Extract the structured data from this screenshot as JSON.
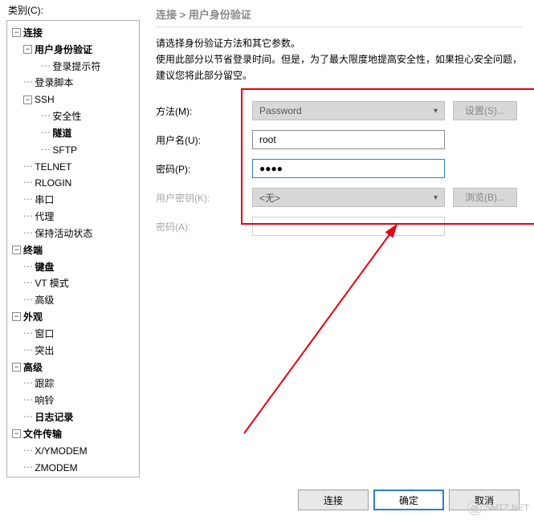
{
  "categoryLabel": "类别(C):",
  "tree": {
    "connection": "连接",
    "userAuth": "用户身份验证",
    "loginPrompt": "登录提示符",
    "loginScript": "登录脚本",
    "ssh": "SSH",
    "security": "安全性",
    "tunnel": "隧道",
    "sftp": "SFTP",
    "telnet": "TELNET",
    "rlogin": "RLOGIN",
    "serial": "串口",
    "proxy": "代理",
    "keepalive": "保持活动状态",
    "terminal": "终端",
    "keyboard": "键盘",
    "vtmode": "VT 模式",
    "advancedTerm": "高级",
    "appearance": "外观",
    "window": "窗口",
    "highlight": "突出",
    "advancedGrp": "高级",
    "trace": "跟踪",
    "bell": "响铃",
    "logging": "日志记录",
    "fileTransfer": "文件传输",
    "xymodem": "X/YMODEM",
    "zmodem": "ZMODEM"
  },
  "breadcrumb": "连接 > 用户身份验证",
  "desc1": "请选择身份验证方法和其它参数。",
  "desc2": "使用此部分以节省登录时间。但是，为了最大限度地提高安全性，如果担心安全问题，建议您将此部分留空。",
  "form": {
    "methodLabel": "方法(M):",
    "methodValue": "Password",
    "settingsBtn": "设置(S)...",
    "userLabel": "用户名(U):",
    "userValue": "root",
    "passLabel": "密码(P):",
    "passValue": "●●●●",
    "keyLabel": "用户密钥(K):",
    "keyValue": "<无>",
    "browseBtn": "浏览(B)...",
    "pass2Label": "密码(A):"
  },
  "buttons": {
    "connect": "连接",
    "ok": "确定",
    "cancel": "取消"
  },
  "watermark": {
    "icon": "值",
    "text": "SMTZ.NET"
  }
}
